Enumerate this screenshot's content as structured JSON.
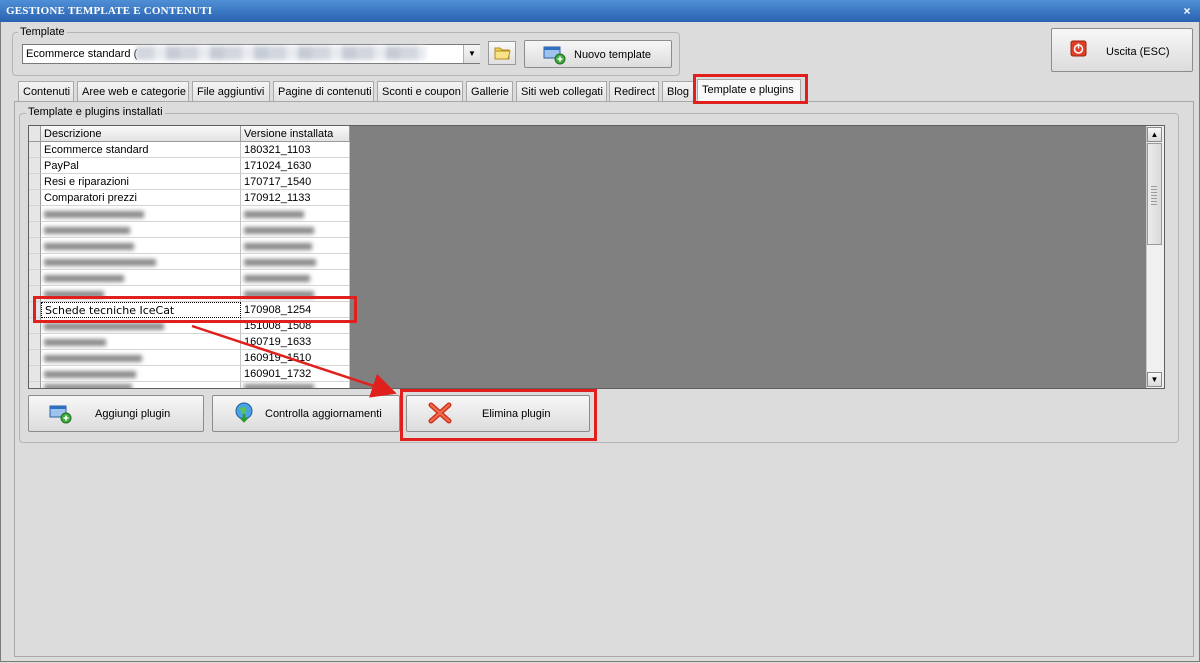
{
  "window": {
    "title": "GESTIONE TEMPLATE E CONTENUTI",
    "close_label": "×"
  },
  "template_group": {
    "label": "Template",
    "selected_value": "Ecommerce standard (",
    "new_button_label": "Nuovo template"
  },
  "exit_button": {
    "label": "Uscita (ESC)"
  },
  "tabs": [
    {
      "label": "Contenuti"
    },
    {
      "label": "Aree web e categorie"
    },
    {
      "label": "File aggiuntivi"
    },
    {
      "label": "Pagine di contenuti"
    },
    {
      "label": "Sconti e coupon"
    },
    {
      "label": "Gallerie"
    },
    {
      "label": "Siti web collegati"
    },
    {
      "label": "Redirect"
    },
    {
      "label": "Blog"
    },
    {
      "label": "Template e plugins"
    }
  ],
  "installed_group": {
    "label": "Template e plugins installati",
    "columns": [
      "Descrizione",
      "Versione installata"
    ],
    "rows": [
      {
        "name": "Ecommerce standard",
        "version": "180321_1103"
      },
      {
        "name": "PayPal",
        "version": "171024_1630"
      },
      {
        "name": "Resi e riparazioni",
        "version": "170717_1540"
      },
      {
        "name": "Comparatori prezzi",
        "version": "170912_1133"
      },
      {
        "name": "Schede tecniche IceCat",
        "version": "170908_1254"
      },
      {
        "name": "",
        "version": "151008_1508"
      },
      {
        "name": "",
        "version": "160719_1633"
      },
      {
        "name": "",
        "version": "160919_1510"
      },
      {
        "name": "",
        "version": "160901_1732"
      }
    ]
  },
  "actions": {
    "add_plugin": "Aggiungi plugin",
    "check_updates": "Controlla aggiornamenti",
    "delete_plugin": "Elimina plugin"
  },
  "colors": {
    "highlight": "#e0201c",
    "titlebar": "#2a62b0"
  }
}
